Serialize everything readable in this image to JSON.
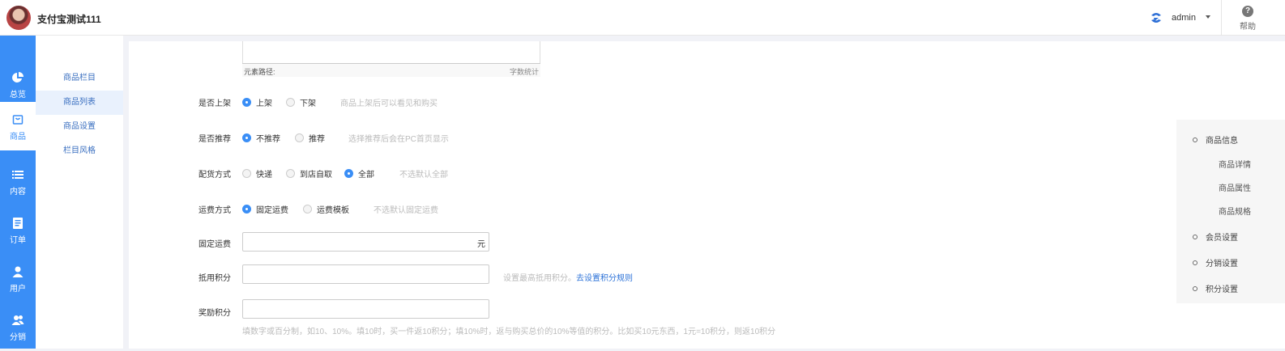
{
  "header": {
    "app_title": "支付宝测试111",
    "user_name": "admin",
    "help_label": "帮助",
    "help_glyph": "?",
    "accent": "#3a8ef6"
  },
  "sidebar": {
    "items": [
      {
        "label": "总览",
        "icon": "pie-chart-icon"
      },
      {
        "label": "商品",
        "icon": "bag-icon",
        "active": true
      },
      {
        "label": "内容",
        "icon": "list-icon"
      },
      {
        "label": "订单",
        "icon": "document-icon"
      },
      {
        "label": "用户",
        "icon": "user-icon"
      },
      {
        "label": "分销",
        "icon": "users-icon"
      }
    ]
  },
  "subnav": {
    "items": [
      {
        "label": "商品栏目"
      },
      {
        "label": "商品列表",
        "active": true
      },
      {
        "label": "商品设置"
      },
      {
        "label": "栏目风格"
      }
    ]
  },
  "editor": {
    "path_label": "元素路径:",
    "count_label": "字数统计"
  },
  "form": {
    "on_shelf": {
      "label": "是否上架",
      "options": [
        "上架",
        "下架"
      ],
      "selected": "上架",
      "hint": "商品上架后可以看见和购买"
    },
    "recommend": {
      "label": "是否推荐",
      "options": [
        "不推荐",
        "推荐"
      ],
      "selected": "不推荐",
      "hint": "选择推荐后会在PC首页显示"
    },
    "delivery": {
      "label": "配货方式",
      "options": [
        "快递",
        "到店自取",
        "全部"
      ],
      "selected": "全部",
      "hint": "不选默认全部"
    },
    "freight": {
      "label": "运费方式",
      "options": [
        "固定运费",
        "运费模板"
      ],
      "selected": "固定运费",
      "hint": "不选默认固定运费"
    },
    "fixed_freight": {
      "label": "固定运费",
      "value": "",
      "suffix": "元"
    },
    "deduct_points": {
      "label": "抵用积分",
      "value": "",
      "hint": "设置最高抵用积分。",
      "link": "去设置积分规则"
    },
    "reward_points": {
      "label": "奖励积分",
      "value": "",
      "hint": "填数字或百分制，如10、10%。填10时，买一件返10积分；填10%时，返与购买总价的10%等值的积分。比如买10元东西，1元=10积分，则返10积分"
    }
  },
  "anchor_nav": {
    "groups": [
      {
        "label": "商品信息",
        "children": [
          "商品详情",
          "商品属性",
          "商品规格"
        ]
      },
      {
        "label": "会员设置",
        "children": []
      },
      {
        "label": "分销设置",
        "children": []
      },
      {
        "label": "积分设置",
        "children": []
      }
    ]
  }
}
